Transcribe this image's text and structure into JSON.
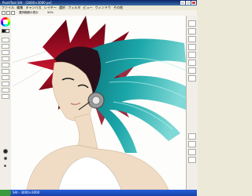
{
  "window": {
    "title": "PaintTool SAI - [3000×3000 px]"
  },
  "menubar": {
    "items": [
      "ファイル",
      "編集",
      "キャンバス",
      "レイヤー",
      "選択",
      "フィルタ",
      "ビュー",
      "ウィンドウ",
      "その他"
    ]
  },
  "toolbar": {
    "option_label": "選択範囲の表示",
    "zoom": "50%"
  },
  "taskbar": {
    "task_label": "SAI - 3000×3000"
  },
  "colors": {
    "hair_teal": "#1aa6a8",
    "hair_red": "#b0102a",
    "skin": "#f0dcc4"
  },
  "icons": {
    "minimize": "minimize-icon",
    "maximize": "maximize-icon",
    "close": "close-icon"
  }
}
